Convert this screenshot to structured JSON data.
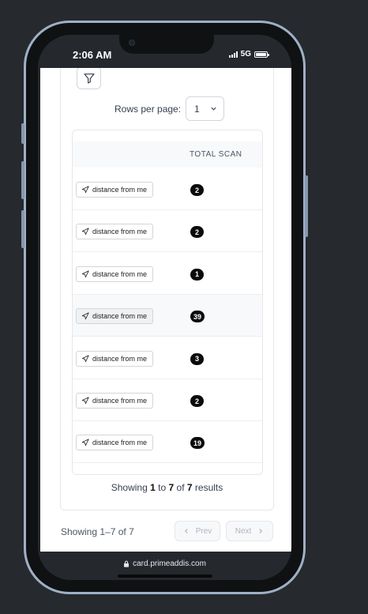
{
  "status": {
    "time": "2:06 AM",
    "network": "5G"
  },
  "toolbar": {
    "filter_icon": "filter-icon"
  },
  "pagination": {
    "rows_per_page_label": "Rows per page:",
    "rows_per_page_value": "1",
    "showing_prefix": "Showing",
    "showing_from": "1",
    "showing_to_word": "to",
    "showing_to": "7",
    "showing_of_word": "of",
    "showing_total": "7",
    "showing_suffix": "results",
    "footer_range": "Showing 1–7 of 7",
    "prev_label": "Prev",
    "next_label": "Next"
  },
  "table": {
    "columns": [
      "",
      "TOTAL SCAN"
    ],
    "rows": [
      {
        "action_label": "distance from me",
        "total_scan": "2"
      },
      {
        "action_label": "distance from me",
        "total_scan": "2"
      },
      {
        "action_label": "distance from me",
        "total_scan": "1"
      },
      {
        "action_label": "distance from me",
        "total_scan": "39"
      },
      {
        "action_label": "distance from me",
        "total_scan": "3"
      },
      {
        "action_label": "distance from me",
        "total_scan": "2"
      },
      {
        "action_label": "distance from me",
        "total_scan": "19"
      }
    ]
  },
  "browser": {
    "url": "card.primeaddis.com"
  },
  "colors": {
    "badge": "#0b0b0b",
    "page_bg": "#262a2e",
    "row_highlight": "#f8f9fb"
  }
}
